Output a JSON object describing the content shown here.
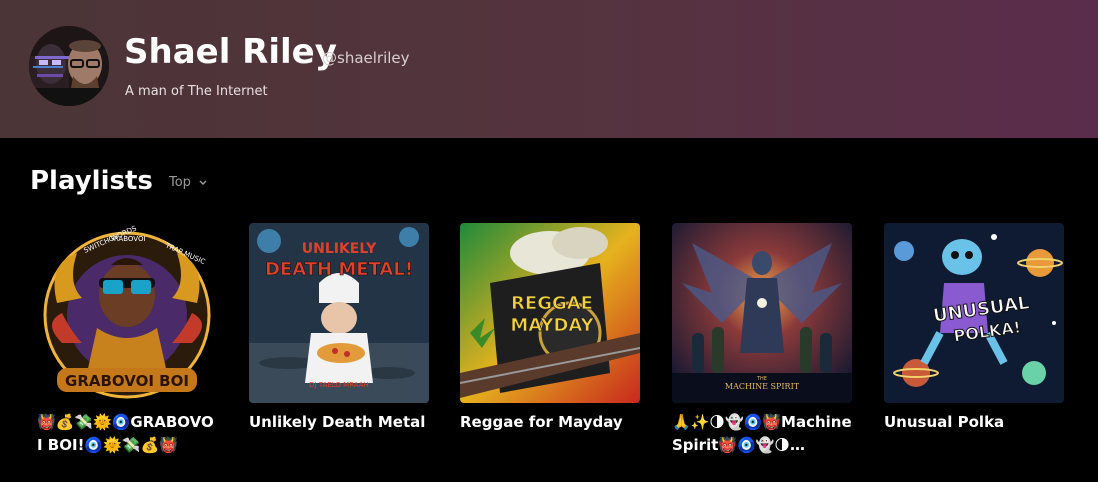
{
  "profile": {
    "name": "Shael Riley",
    "handle": "@shaelriley",
    "bio": "A man of The Internet"
  },
  "playlists_section": {
    "title": "Playlists",
    "sort": {
      "selected": "Top"
    }
  },
  "playlists": [
    {
      "title": "👹💰💸🌞🧿GRABOVOI BOI!🧿🌞💸💰👹",
      "cover_text": "GRABOVOI BOI",
      "cover_arc_text": [
        "SWITCH WORDS",
        "GRABOVOI",
        "TRAP MUSIC"
      ]
    },
    {
      "title": "Unlikely Death Metal",
      "cover_text": [
        "UNLIKELY",
        "DEATH METAL!"
      ],
      "cover_subtext": "DJ TAELO MRAAH"
    },
    {
      "title": "Reggae for Mayday",
      "cover_text": [
        "REGGAE",
        "MAYDAY"
      ]
    },
    {
      "title": "🙏✨🌗👻🧿👹Machine Spirit👹🧿👻🌗…",
      "cover_text": "MACHINE SPIRIT",
      "cover_subtext": "THE"
    },
    {
      "title": "Unusual Polka",
      "cover_text": [
        "UNUSUAL",
        "POLKA!"
      ]
    }
  ],
  "colors": {
    "header_gradient_start": "#4b3536",
    "header_gradient_end": "#5b2d4c",
    "background": "#000000"
  }
}
